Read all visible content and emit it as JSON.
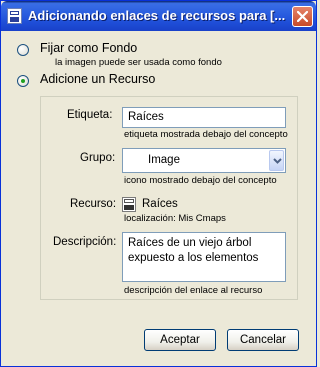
{
  "window": {
    "title": "Adicionando enlaces de recursos para [..."
  },
  "options": {
    "background": {
      "label": "Fijar como Fondo",
      "hint": "la imagen puede ser usada como fondo",
      "selected": false
    },
    "resource": {
      "label": "Adicione un Recurso",
      "selected": true
    }
  },
  "form": {
    "label_field": {
      "label": "Etiqueta:",
      "value": "Raíces",
      "hint": "etiqueta mostrada debajo del concepto"
    },
    "group_field": {
      "label": "Grupo:",
      "value": "Image",
      "hint": "icono mostrado debajo del concepto"
    },
    "resource_field": {
      "label": "Recurso:",
      "value": "Raíces",
      "location": "localización: Mis Cmaps"
    },
    "description_field": {
      "label": "Descripción:",
      "value": "Raíces de un viejo árbol expuesto a los elementos",
      "hint": "descripción del enlace al recurso"
    }
  },
  "buttons": {
    "accept": "Aceptar",
    "cancel": "Cancelar"
  },
  "colors": {
    "title_bar": "#2B5FE0",
    "close_button": "#C74A29",
    "window_bg": "#ECE9D8",
    "radio_dot": "#21A121"
  }
}
